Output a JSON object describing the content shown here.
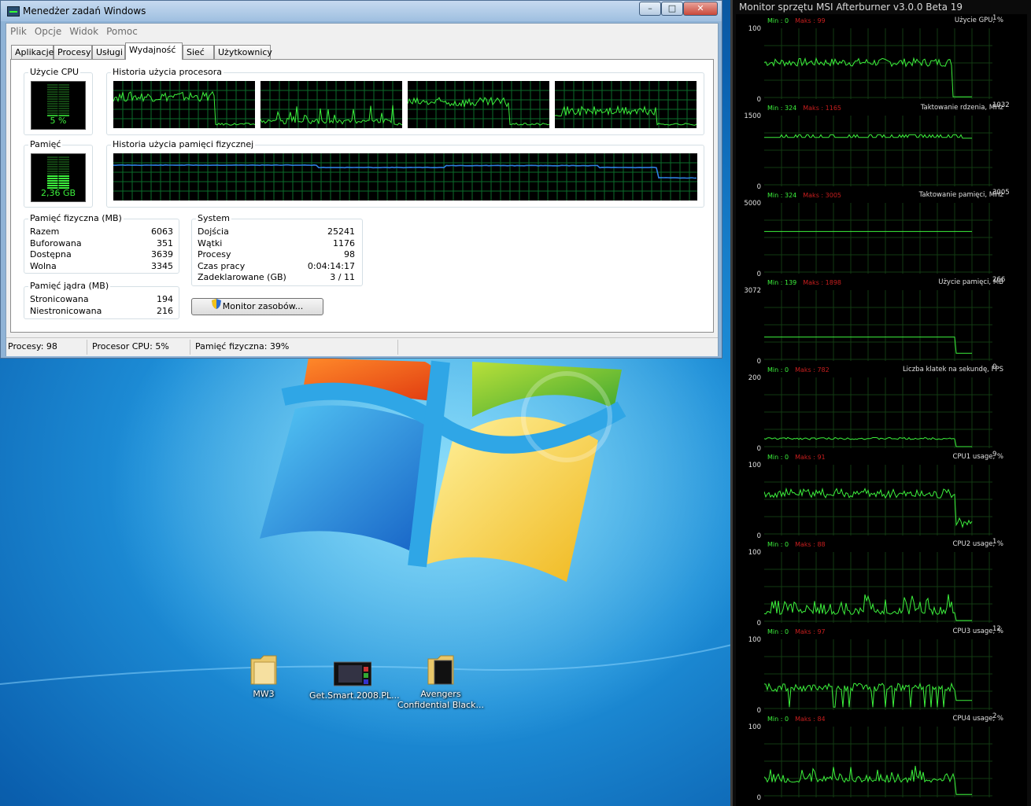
{
  "task_manager": {
    "title": "Menedżer zadań Windows",
    "window_buttons": {
      "minimize": "–",
      "maximize": "□",
      "close": "✕"
    },
    "menu": [
      "Plik",
      "Opcje",
      "Widok",
      "Pomoc"
    ],
    "tabs": [
      "Aplikacje",
      "Procesy",
      "Usługi",
      "Wydajność",
      "Sieć",
      "Użytkownicy"
    ],
    "active_tab": "Wydajność",
    "cpu_usage": {
      "label": "Użycie CPU",
      "value": "5 %",
      "percent": 5
    },
    "cpu_history": {
      "label": "Historia użycia procesora"
    },
    "memory": {
      "label": "Pamięć",
      "value": "2,36 GB",
      "percent": 39
    },
    "memory_history": {
      "label": "Historia użycia pamięci fizycznej"
    },
    "physical_memory": {
      "label": "Pamięć fizyczna (MB)",
      "rows": [
        {
          "k": "Razem",
          "v": "6063"
        },
        {
          "k": "Buforowana",
          "v": "351"
        },
        {
          "k": "Dostępna",
          "v": "3639"
        },
        {
          "k": "Wolna",
          "v": "3345"
        }
      ]
    },
    "kernel_memory": {
      "label": "Pamięć jądra (MB)",
      "rows": [
        {
          "k": "Stronicowana",
          "v": "194"
        },
        {
          "k": "Niestronicowana",
          "v": "216"
        }
      ]
    },
    "system": {
      "label": "System",
      "rows": [
        {
          "k": "Dojścia",
          "v": "25241"
        },
        {
          "k": "Wątki",
          "v": "1176"
        },
        {
          "k": "Procesy",
          "v": "98"
        },
        {
          "k": "Czas pracy",
          "v": "0:04:14:17"
        },
        {
          "k": "Zadeklarowane (GB)",
          "v": "3 / 11"
        }
      ]
    },
    "resource_monitor_button": "Monitor zasobów...",
    "status": {
      "processes": "Procesy: 98",
      "cpu": "Procesor CPU: 5%",
      "memory": "Pamięć fizyczna: 39%"
    }
  },
  "desktop_icons": [
    {
      "label": "MW3",
      "icon": "folder-icon"
    },
    {
      "label": "Get.Smart.2008.PL...",
      "icon": "video-file-icon"
    },
    {
      "label": "Avengers Confidential Black...",
      "icon": "folder-icon"
    }
  ],
  "afterburner": {
    "title": "Monitor sprzętu MSI Afterburner v3.0.0 Beta 19",
    "graphs": [
      {
        "title": "Użycie GPU, %",
        "min_label": "Min : 0",
        "max_label": "Maks : 99",
        "y_max": "100",
        "y_min": "0",
        "current": "1",
        "color": "#3cf03c"
      },
      {
        "title": "Taktowanie rdzenia, MHz",
        "min_label": "Min : 324",
        "max_label": "Maks : 1165",
        "y_max": "1500",
        "y_min": "0",
        "current": "1032",
        "color": "#3cf03c"
      },
      {
        "title": "Taktowanie pamięci, MHz",
        "min_label": "Min : 324",
        "max_label": "Maks : 3005",
        "y_max": "5000",
        "y_min": "0",
        "current": "3005",
        "color": "#3cf03c"
      },
      {
        "title": "Użycie pamięci, MB",
        "min_label": "Min : 139",
        "max_label": "Maks : 1898",
        "y_max": "3072",
        "y_min": "0",
        "current": "266",
        "color": "#3cf03c"
      },
      {
        "title": "Liczba klatek na sekundę, FPS",
        "min_label": "Min : 0",
        "max_label": "Maks : 782",
        "y_max": "200",
        "y_min": "0",
        "current": "0",
        "color": "#3cf03c"
      },
      {
        "title": "CPU1 usage, %",
        "min_label": "Min : 0",
        "max_label": "Maks : 91",
        "y_max": "100",
        "y_min": "0",
        "current": "9",
        "color": "#3cf03c"
      },
      {
        "title": "CPU2 usage, %",
        "min_label": "Min : 0",
        "max_label": "Maks : 88",
        "y_max": "100",
        "y_min": "0",
        "current": "1",
        "color": "#3cf03c"
      },
      {
        "title": "CPU3 usage, %",
        "min_label": "Min : 0",
        "max_label": "Maks : 97",
        "y_max": "100",
        "y_min": "0",
        "current": "12",
        "color": "#3cf03c"
      },
      {
        "title": "CPU4 usage, %",
        "min_label": "Min : 0",
        "max_label": "Maks : 84",
        "y_max": "100",
        "y_min": "0",
        "current": "2",
        "color": "#3cf03c"
      }
    ]
  },
  "colors": {
    "graph_green": "#3cf03c",
    "memory_line_blue": "#2d7fe0",
    "max_label_red": "#c81e1e",
    "desktop_blue": "#1e8fd8"
  }
}
